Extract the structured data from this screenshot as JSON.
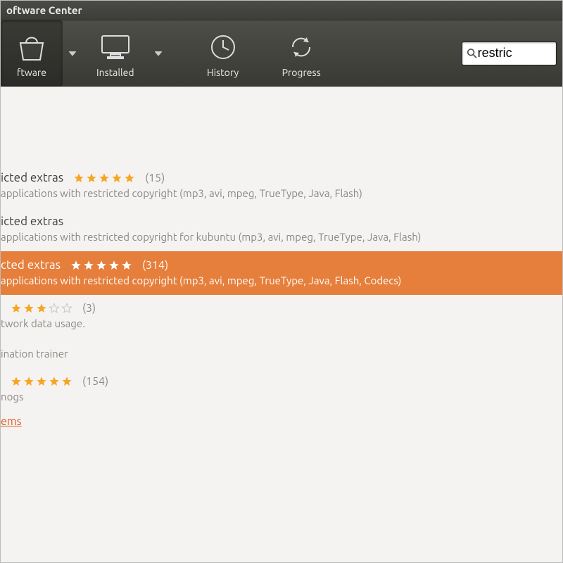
{
  "window": {
    "title": "oftware Center"
  },
  "toolbar": {
    "software_label": "ftware",
    "installed_label": "Installed",
    "history_label": "History",
    "progress_label": "Progress"
  },
  "search": {
    "value": "restric"
  },
  "items": [
    {
      "name": "icted extras",
      "count": "(15)",
      "stars": 5,
      "desc": "applications with restricted copyright (mp3, avi, mpeg, TrueType, Java, Flash)",
      "selected": false
    },
    {
      "name": "icted extras",
      "count": "",
      "stars": 0,
      "desc": "applications with restricted copyright for kubuntu (mp3, avi, mpeg, TrueType, Java, Flash)",
      "selected": false
    },
    {
      "name": "cted extras",
      "count": "(314)",
      "stars": 5,
      "desc": "applications with restricted copyright (mp3, avi, mpeg, TrueType, Java, Flash, Codecs)",
      "selected": true
    },
    {
      "name": "",
      "count": "(3)",
      "stars": 3,
      "desc": "twork data usage.",
      "selected": false
    },
    {
      "name": "",
      "count": "",
      "stars": 0,
      "desc": "ination trainer",
      "selected": false
    },
    {
      "name": "",
      "count": "(154)",
      "stars": 5,
      "desc": "nogs",
      "selected": false
    }
  ],
  "link_label": "ems",
  "colors": {
    "accent": "#e67f3c",
    "star_gold": "#f6a623",
    "star_white": "#ffffff",
    "star_empty": "#c9c6c2"
  }
}
